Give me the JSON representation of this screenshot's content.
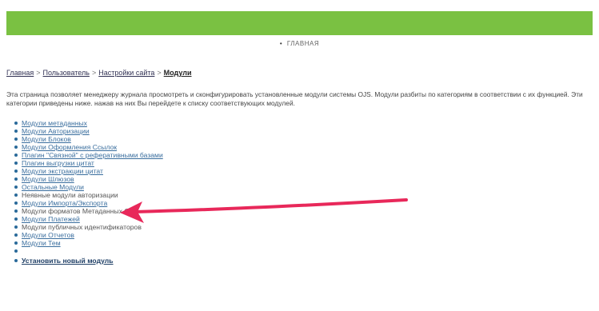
{
  "nav": {
    "home_link": "ГЛАВНАЯ"
  },
  "breadcrumb": {
    "items": [
      "Главная",
      "Пользователь",
      "Настройки сайта"
    ],
    "current": "Модули",
    "separator": ">"
  },
  "intro": "Эта страница позволяет менеджеру журнала просмотреть и сконфигурировать установленные модули системы OJS. Модули разбиты по категориям в соответствии с их функцией. Эти категории приведены ниже. нажав на них Вы перейдете к списку соответствующих модулей.",
  "modules": [
    {
      "label": "Модули метаданных",
      "link": true
    },
    {
      "label": "Модули Авторизации",
      "link": true
    },
    {
      "label": "Модули Блоков",
      "link": true
    },
    {
      "label": "Модули Оформления Ссылок",
      "link": true
    },
    {
      "label": "Плагин \"Связной\" с реферативными базами",
      "link": true
    },
    {
      "label": "Плагин выгрузки цитат",
      "link": true
    },
    {
      "label": "Модули экстракции цитат",
      "link": true
    },
    {
      "label": "Модули Шлюзов",
      "link": true
    },
    {
      "label": "Остальные Модули",
      "link": true
    },
    {
      "label": "Неявные модули авторизации",
      "link": false
    },
    {
      "label": "Модули Импорта/Экспорта",
      "link": true
    },
    {
      "label": "Модули форматов Метаданных OAI",
      "link": false
    },
    {
      "label": "Модули Платежей",
      "link": true
    },
    {
      "label": "Модули публичных идентификаторов",
      "link": false
    },
    {
      "label": "Модули Отчетов",
      "link": true
    },
    {
      "label": "Модули Тем",
      "link": true
    },
    {
      "label": "",
      "link": false
    }
  ],
  "install_link": "Установить новый модуль",
  "colors": {
    "header_bar": "#7ac142",
    "arrow": "#e8285a",
    "link": "#3a6e9e"
  }
}
